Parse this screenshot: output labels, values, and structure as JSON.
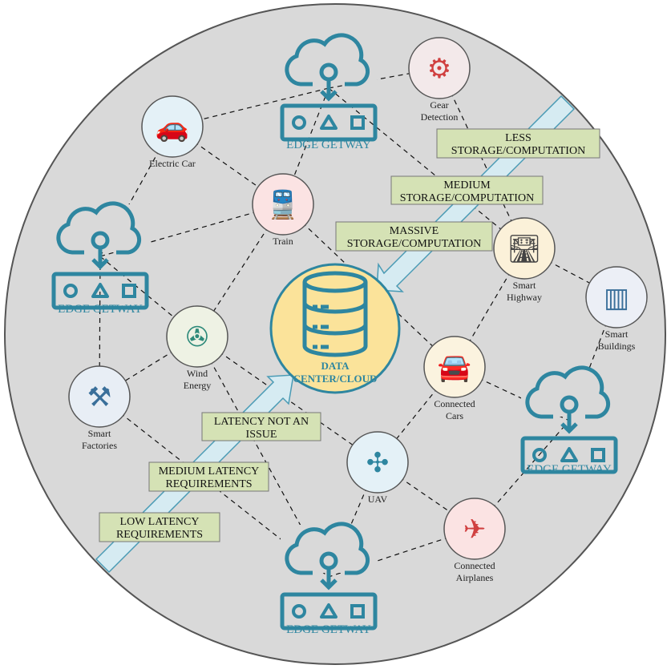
{
  "colors": {
    "background": "#d9d9d9",
    "border": "#555555",
    "teal": "#2e86a0",
    "data_center_fill": "#fbe39a",
    "box_fill": "#d5e2b5",
    "arrow_fill": "#d6ebf2"
  },
  "data_center": {
    "line1": "DATA",
    "line2": "CENTER/CLOUD",
    "icon": "database-icon"
  },
  "gateways": [
    {
      "id": "top",
      "label": "EDGE GETWAY"
    },
    {
      "id": "left",
      "label": "EDGE GETWAY"
    },
    {
      "id": "right",
      "label": "EDGE GETWAY"
    },
    {
      "id": "bottom",
      "label": "EDGE GETWAY"
    }
  ],
  "nodes": [
    {
      "id": "gear",
      "lines": [
        "Gear",
        "Detection"
      ],
      "icon": "gear-icon"
    },
    {
      "id": "ecar",
      "lines": [
        "Electric Car"
      ],
      "icon": "electric-car-icon"
    },
    {
      "id": "train",
      "lines": [
        "Train"
      ],
      "icon": "train-icon"
    },
    {
      "id": "wind",
      "lines": [
        "Wind",
        "Energy"
      ],
      "icon": "wind-turbine-icon"
    },
    {
      "id": "factory",
      "lines": [
        "Smart",
        "Factories"
      ],
      "icon": "robot-arm-icon"
    },
    {
      "id": "highway",
      "lines": [
        "Smart",
        "Highway"
      ],
      "icon": "highway-icon"
    },
    {
      "id": "buildings",
      "lines": [
        "Smart",
        "Buildings"
      ],
      "icon": "building-icon"
    },
    {
      "id": "cars",
      "lines": [
        "Connected",
        "Cars"
      ],
      "icon": "connected-car-icon"
    },
    {
      "id": "uav",
      "lines": [
        "UAV"
      ],
      "icon": "drone-icon"
    },
    {
      "id": "planes",
      "lines": [
        "Connected",
        "Airplanes"
      ],
      "icon": "airplane-icon"
    }
  ],
  "tiers": [
    {
      "id": "less",
      "lines": [
        "LESS",
        "STORAGE/COMPUTATION"
      ]
    },
    {
      "id": "medium",
      "lines": [
        "MEDIUM",
        "STORAGE/COMPUTATION"
      ]
    },
    {
      "id": "massive",
      "lines": [
        "MASSIVE",
        "STORAGE/COMPUTATION"
      ]
    },
    {
      "id": "latency-none",
      "lines": [
        "LATENCY NOT AN",
        "ISSUE"
      ]
    },
    {
      "id": "latency-medium",
      "lines": [
        "MEDIUM LATENCY",
        "REQUIREMENTS"
      ]
    },
    {
      "id": "latency-low",
      "lines": [
        "LOW LATENCY",
        "REQUIREMENTS"
      ]
    }
  ],
  "links": [
    [
      "gw-top",
      "ecar"
    ],
    [
      "gw-top",
      "gear"
    ],
    [
      "gw-top",
      "train"
    ],
    [
      "gw-top",
      "highway"
    ],
    [
      "gear",
      "highway"
    ],
    [
      "ecar",
      "train"
    ],
    [
      "ecar",
      "gw-left"
    ],
    [
      "train",
      "gw-left"
    ],
    [
      "train",
      "wind"
    ],
    [
      "train",
      "cars"
    ],
    [
      "gw-left",
      "wind"
    ],
    [
      "gw-left",
      "factory"
    ],
    [
      "wind",
      "factory"
    ],
    [
      "wind",
      "uav"
    ],
    [
      "wind",
      "gw-bottom"
    ],
    [
      "factory",
      "gw-bottom"
    ],
    [
      "highway",
      "cars"
    ],
    [
      "highway",
      "buildings"
    ],
    [
      "buildings",
      "gw-right"
    ],
    [
      "cars",
      "gw-right"
    ],
    [
      "cars",
      "uav"
    ],
    [
      "uav",
      "gw-bottom"
    ],
    [
      "uav",
      "planes"
    ],
    [
      "planes",
      "gw-right"
    ],
    [
      "planes",
      "gw-bottom"
    ]
  ]
}
